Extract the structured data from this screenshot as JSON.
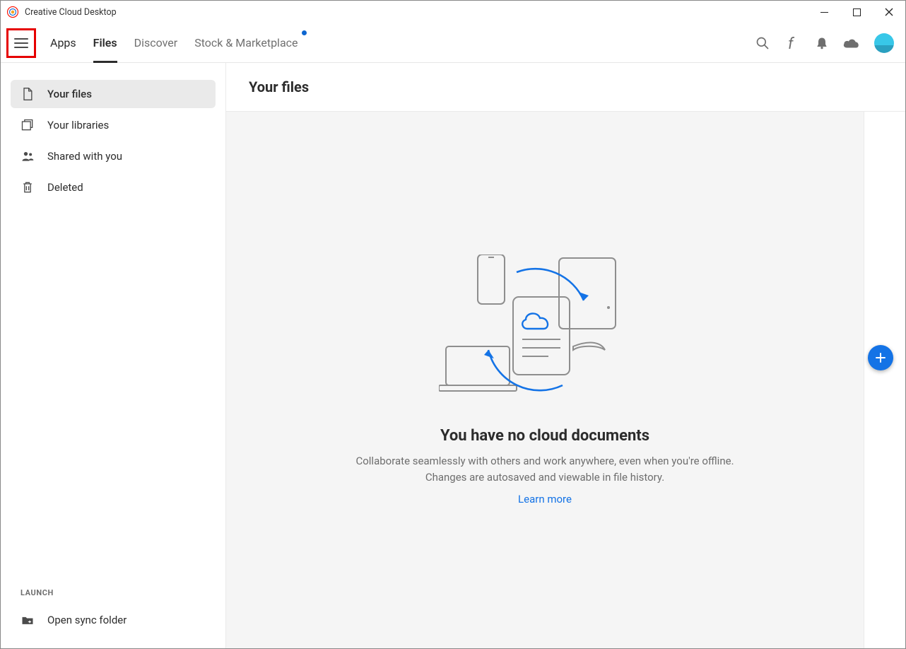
{
  "window": {
    "title": "Creative Cloud Desktop"
  },
  "tabs": {
    "apps": "Apps",
    "files": "Files",
    "discover": "Discover",
    "stock": "Stock & Marketplace"
  },
  "sidebar": {
    "your_files": "Your files",
    "your_libraries": "Your libraries",
    "shared": "Shared with you",
    "deleted": "Deleted",
    "launch_label": "LAUNCH",
    "open_sync": "Open sync folder"
  },
  "main": {
    "heading": "Your files",
    "empty_title": "You have no cloud documents",
    "empty_desc": "Collaborate seamlessly with others and work anywhere, even when you're offline. Changes are autosaved and viewable in file history.",
    "learn_more": "Learn more"
  }
}
